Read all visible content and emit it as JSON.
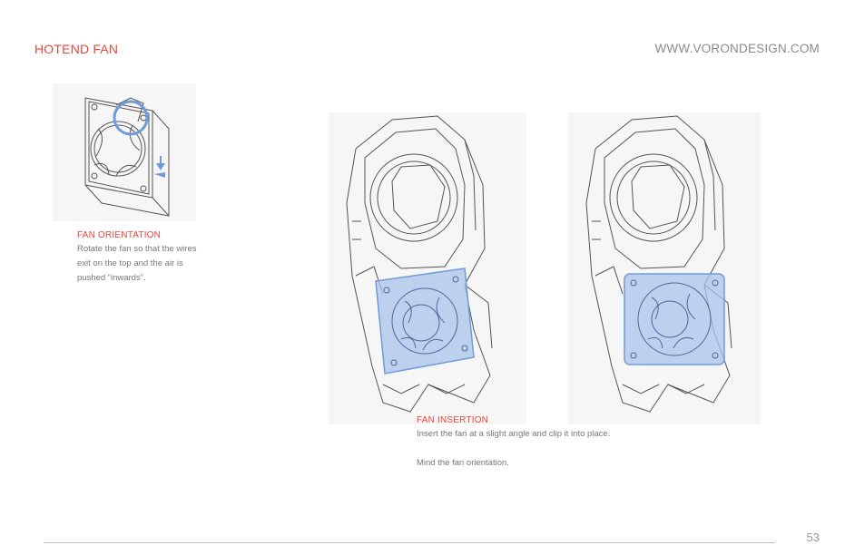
{
  "header": {
    "section_title": "HOTEND FAN",
    "website": "WWW.VORONDESIGN.COM"
  },
  "fan_orientation": {
    "title": "FAN ORIENTATION",
    "body_lines": [
      "Rotate the fan so that the wires",
      "exit on the top and the air is",
      "pushed “inwards”."
    ]
  },
  "fan_insertion": {
    "title": "FAN INSERTION",
    "body_lines": [
      "Insert the fan at a slight angle and clip it into place.",
      "",
      "Mind the fan orientation."
    ]
  },
  "footer": {
    "page_number": "53"
  },
  "colors": {
    "accent_red": "#e8463a",
    "highlight_blue": "#6f9bd8",
    "line_gray": "#555555"
  }
}
